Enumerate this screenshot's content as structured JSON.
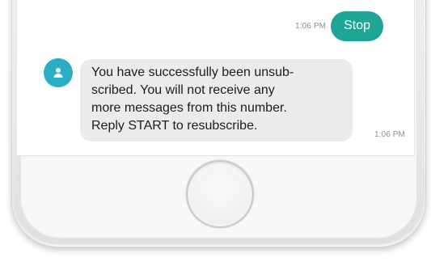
{
  "conversation": {
    "sent": {
      "text": "Stop",
      "time": "1:06 PM"
    },
    "received": {
      "text": "You have successfully been unsub-\nscribed. You will not receive any\nmore messages from this number.\nReply START to resubscribe.",
      "time": "1:06 PM"
    }
  },
  "colors": {
    "sent_bubble": "#1fa596",
    "avatar": "#2aaec6",
    "received_bubble": "#ebebed"
  },
  "icons": {
    "avatar": "person-icon"
  }
}
